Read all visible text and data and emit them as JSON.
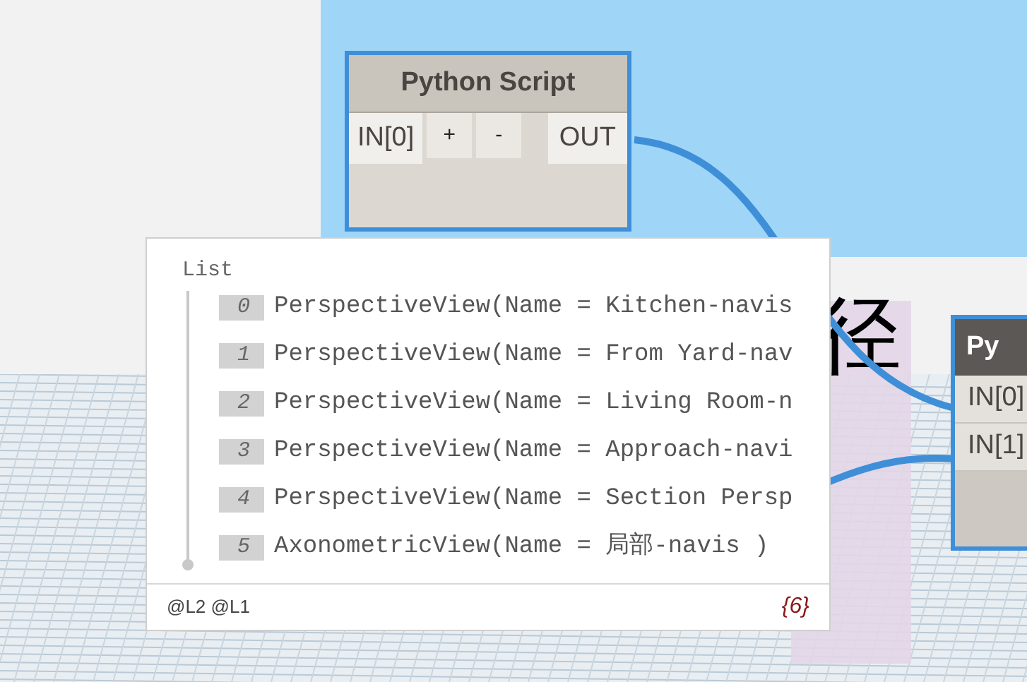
{
  "python_node": {
    "title": "Python Script",
    "input": "IN[0]",
    "add": "+",
    "remove": "-",
    "output": "OUT"
  },
  "second_node": {
    "title": "Py",
    "inputs": [
      "IN[0]",
      "IN[1]"
    ]
  },
  "label_char": "径",
  "preview": {
    "title": "List",
    "items": [
      {
        "index": "0",
        "text": "PerspectiveView(Name = Kitchen-navis"
      },
      {
        "index": "1",
        "text": "PerspectiveView(Name = From Yard-nav"
      },
      {
        "index": "2",
        "text": "PerspectiveView(Name = Living Room-n"
      },
      {
        "index": "3",
        "text": "PerspectiveView(Name = Approach-navi"
      },
      {
        "index": "4",
        "text": "PerspectiveView(Name = Section Persp"
      },
      {
        "index": "5",
        "text": "AxonometricView(Name = 局部-navis )"
      }
    ],
    "levels": "@L2 @L1",
    "count": "{6}"
  }
}
